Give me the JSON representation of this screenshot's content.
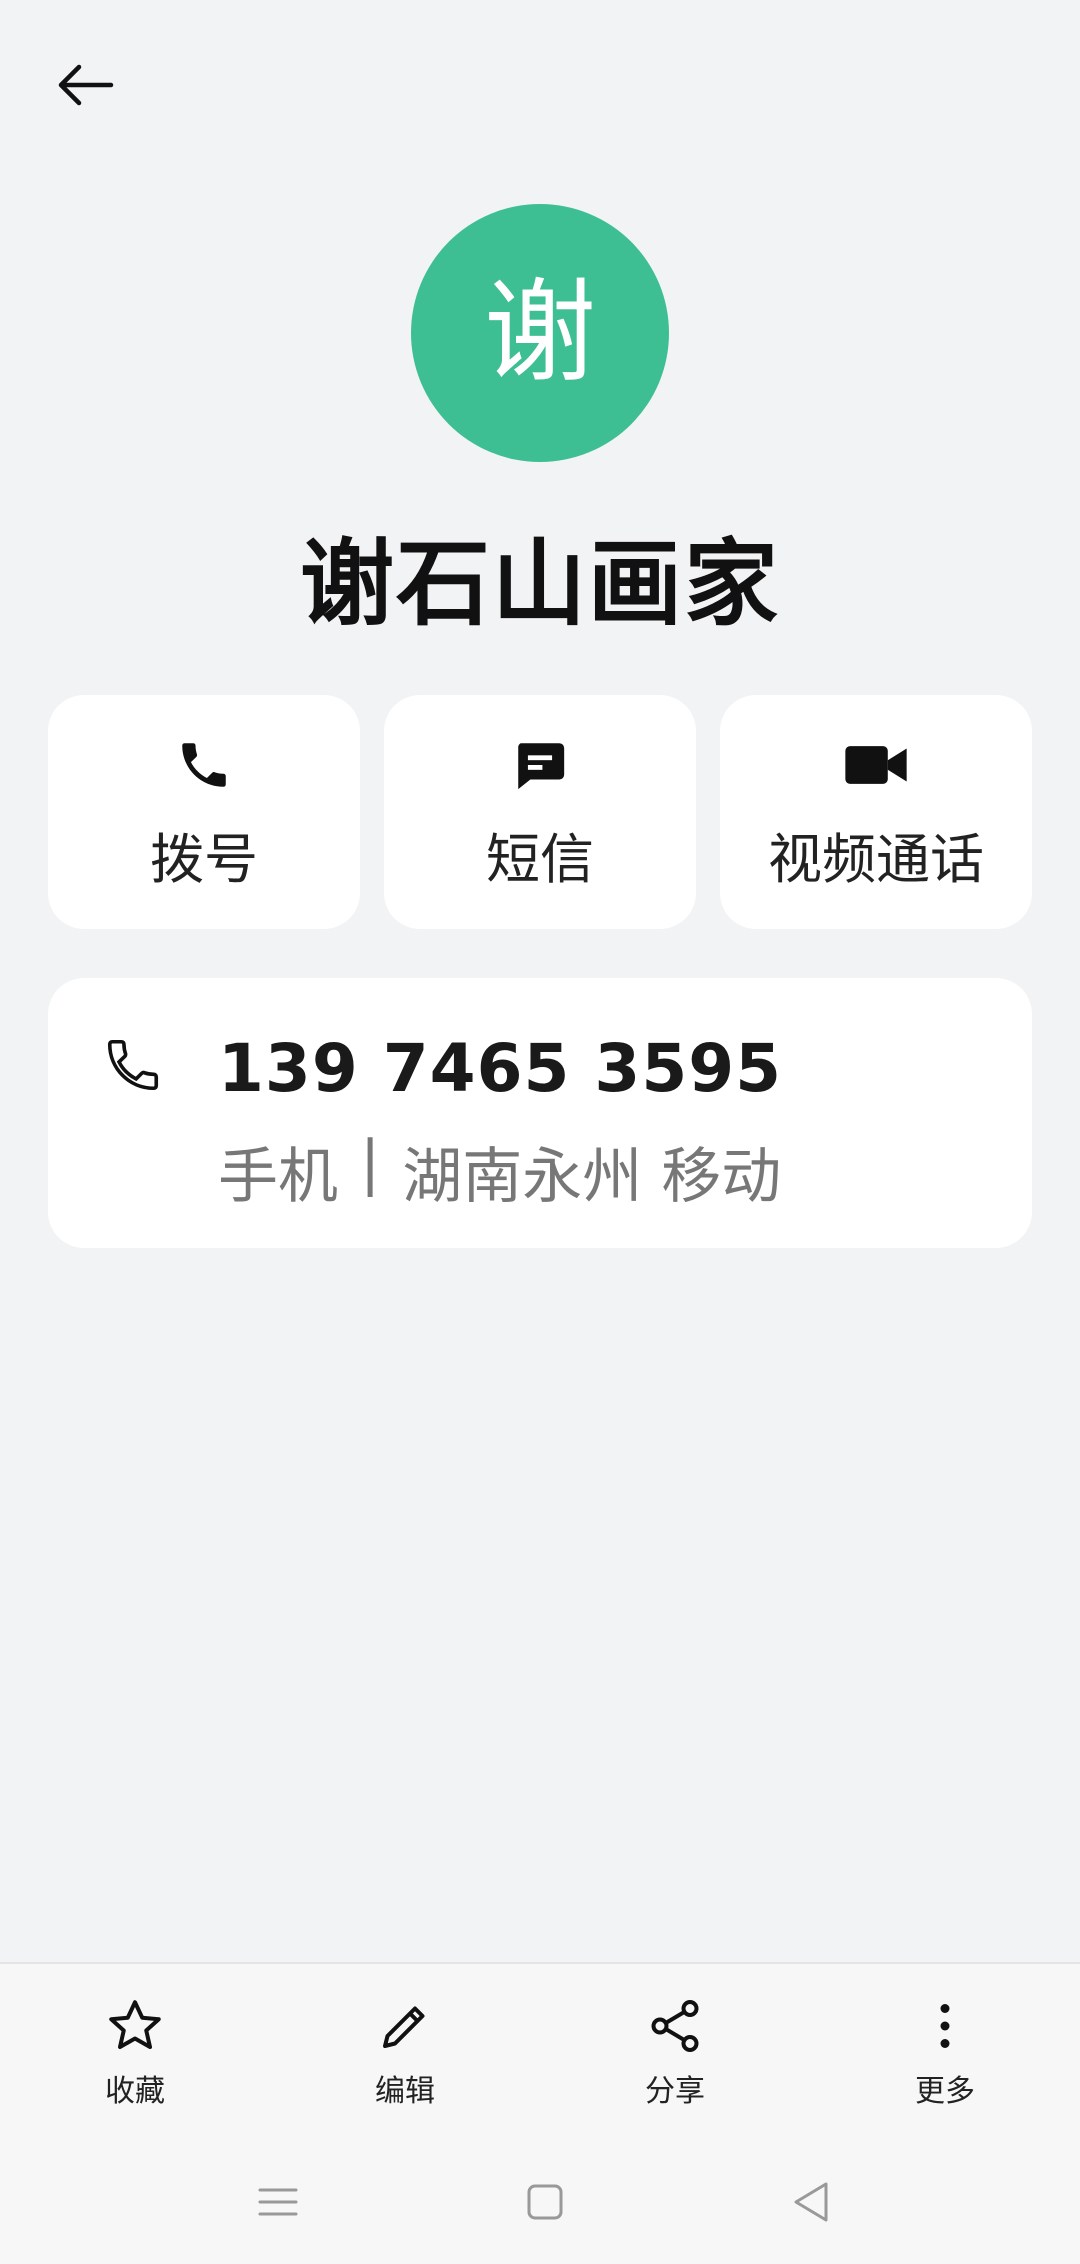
{
  "header": {
    "back_icon": "arrow-left-icon"
  },
  "contact": {
    "avatar_letter": "谢",
    "avatar_color": "#3dbf93",
    "name": "谢石山画家"
  },
  "actions": [
    {
      "label": "拨号",
      "icon": "phone-icon"
    },
    {
      "label": "短信",
      "icon": "message-icon"
    },
    {
      "label": "视频通话",
      "icon": "video-icon"
    }
  ],
  "phone": {
    "number": "139 7465 3595",
    "type": "手机",
    "separator": "|",
    "location": "湖南永州 移动"
  },
  "bottom_actions": [
    {
      "label": "收藏",
      "icon": "star-icon"
    },
    {
      "label": "编辑",
      "icon": "pencil-icon"
    },
    {
      "label": "分享",
      "icon": "share-icon"
    },
    {
      "label": "更多",
      "icon": "more-vertical-icon"
    }
  ],
  "system_nav": {
    "menu_icon": "menu-icon",
    "home_icon": "home-square-icon",
    "back_icon": "back-triangle-icon"
  }
}
